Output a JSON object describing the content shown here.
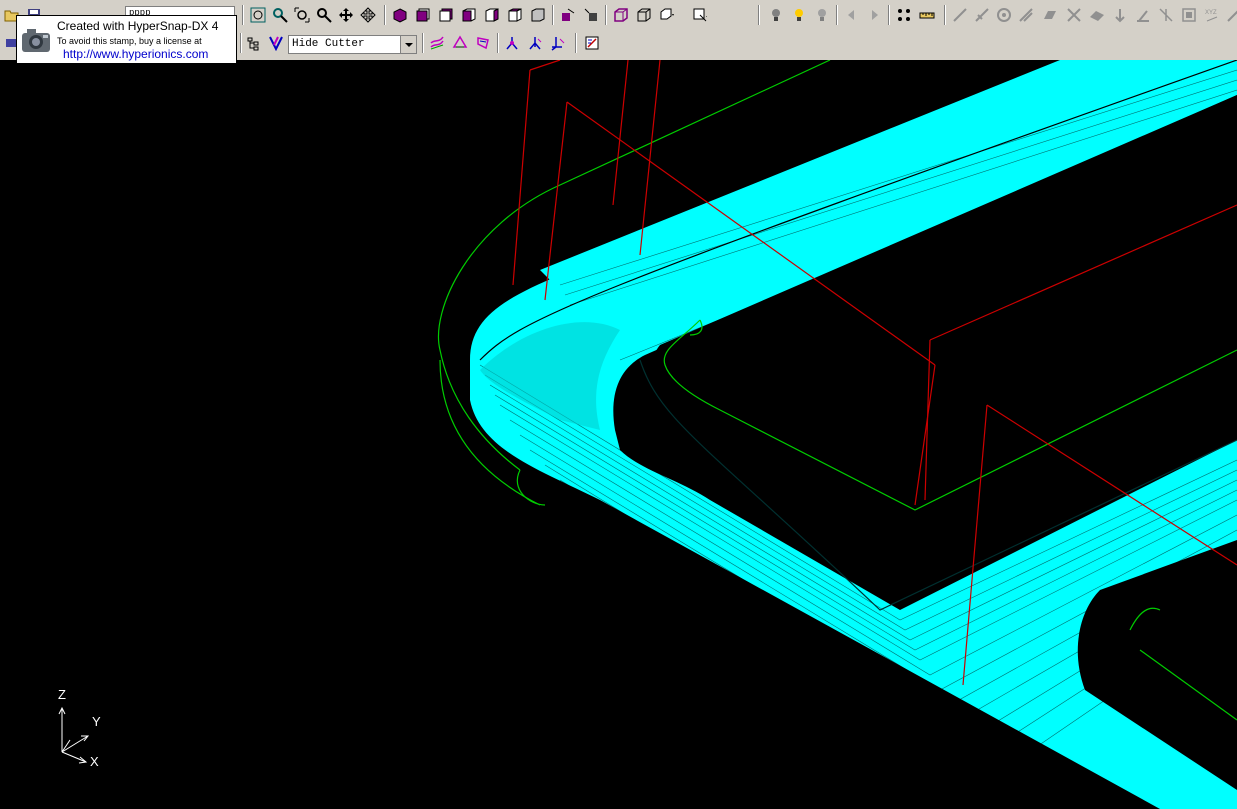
{
  "toolbar": {
    "combo_upper_value": "pppp",
    "hide_cutter_value": "Hide Cutter"
  },
  "stamp": {
    "line1": "Created with HyperSnap-DX 4",
    "line2": "To avoid this stamp, buy a license at",
    "line3": "http://www.hyperionics.com"
  },
  "axes": {
    "z": "Z",
    "y": "Y",
    "x": "X"
  },
  "colors": {
    "toolpath": "#00ffff",
    "boundary": "#00cc00",
    "links": "#cc0000",
    "background": "#000000",
    "toolbar": "#d4d0c8"
  },
  "icons": {
    "row1": [
      "open-icon",
      "save-icon",
      "zoom-fit-icon",
      "zoom-window-icon",
      "zoom-box-icon",
      "zoom-icon",
      "pan-icon",
      "rotate-icon",
      "view-iso-icon",
      "view-front-icon",
      "view-back-icon",
      "view-left-icon",
      "view-right-icon",
      "view-top-icon",
      "light-icon",
      "shade-icon",
      "wireframe-icon",
      "box-view-icon",
      "select-icon",
      "bulb-on-icon",
      "bulb-icon",
      "bulb-off-icon",
      "arrow-back-icon",
      "arrow-forward-icon",
      "analyze-icon",
      "measure-icon",
      "line-tool-icon",
      "cross-tool-icon",
      "circle-tool-icon",
      "slash-tool-icon",
      "plane-tool-icon",
      "x-tool-icon",
      "surface-tool-icon",
      "arrow-tool-icon",
      "normal-tool-icon",
      "box-tool-icon",
      "xyz-icon"
    ],
    "row2": [
      "mesh-icon",
      "model-icon",
      "hide-cutter-icon",
      "toolpath-edit-icon",
      "boundary-icon",
      "pattern-icon",
      "tree-icon",
      "branch-icon",
      "node-icon",
      "report-icon"
    ]
  }
}
